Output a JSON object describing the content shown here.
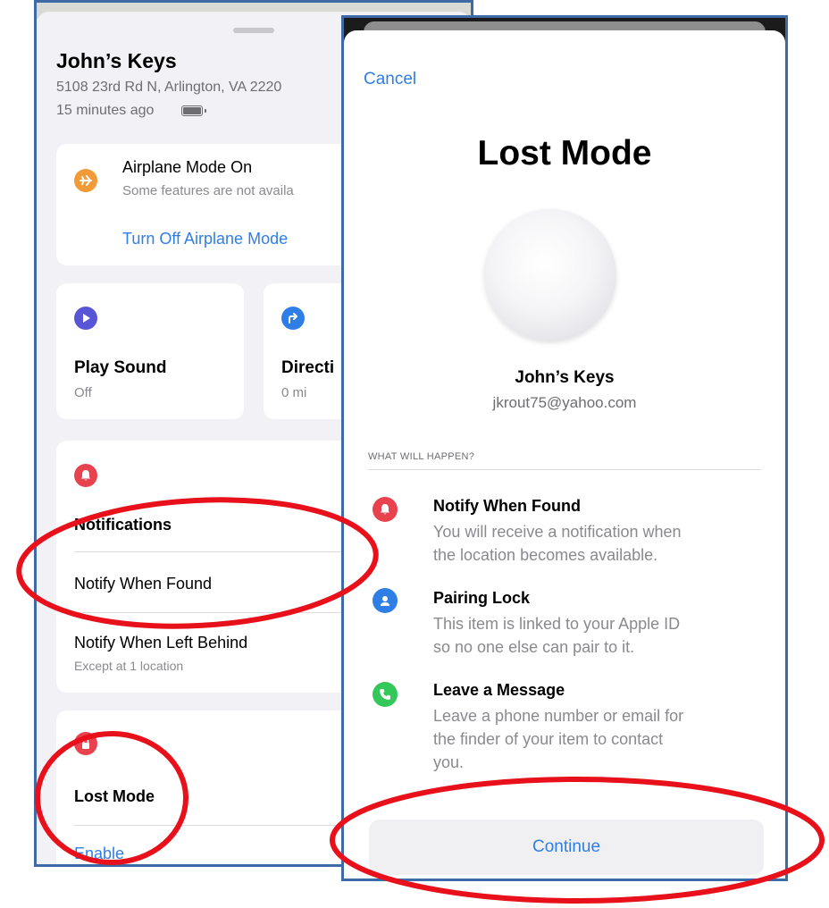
{
  "left_screen": {
    "title": "John’s Keys",
    "address": "5108 23rd Rd N, Arlington, VA 2220",
    "time": "15 minutes ago",
    "airplane": {
      "title": "Airplane Mode On",
      "subtitle": "Some features are not availa",
      "action": "Turn Off Airplane Mode",
      "icon": "airplane-icon",
      "color": "#f19a37"
    },
    "play_sound": {
      "title": "Play Sound",
      "status": "Off",
      "icon": "play-icon",
      "color": "#5856d6"
    },
    "directions": {
      "title": "Directi",
      "distance": "0 mi",
      "icon": "directions-arrow-icon",
      "color": "#2f7ee6"
    },
    "notifications": {
      "heading": "Notifications",
      "notify_found": "Notify When Found",
      "notify_left": "Notify When Left Behind",
      "notify_left_sub": "Except at 1 location",
      "icon": "bell-icon",
      "color": "#e8424f"
    },
    "lost_mode": {
      "heading": "Lost Mode",
      "action": "Enable",
      "icon": "lock-icon",
      "color": "#e8424f"
    }
  },
  "modal": {
    "cancel": "Cancel",
    "title": "Lost Mode",
    "item_name": "John’s Keys",
    "email": "jkrout75@yahoo.com",
    "section_label": "WHAT WILL HAPPEN?",
    "features": [
      {
        "title": "Notify When Found",
        "desc_line1": "You will receive a notification when",
        "desc_line2": "the location becomes available.",
        "icon": "bell-icon",
        "color": "#e8424f"
      },
      {
        "title": "Pairing Lock",
        "desc_line1": "This item is linked to your Apple ID",
        "desc_line2": "so no one else can pair to it.",
        "icon": "person-icon",
        "color": "#2f7ee6"
      },
      {
        "title": "Leave a Message",
        "desc_line1": "Leave a phone number or email for",
        "desc_line2": "the finder of your item to contact",
        "desc_line3": "you.",
        "icon": "phone-icon",
        "color": "#34c759"
      }
    ],
    "continue": "Continue"
  },
  "annotations": {
    "highlight_color": "#e8101a"
  }
}
